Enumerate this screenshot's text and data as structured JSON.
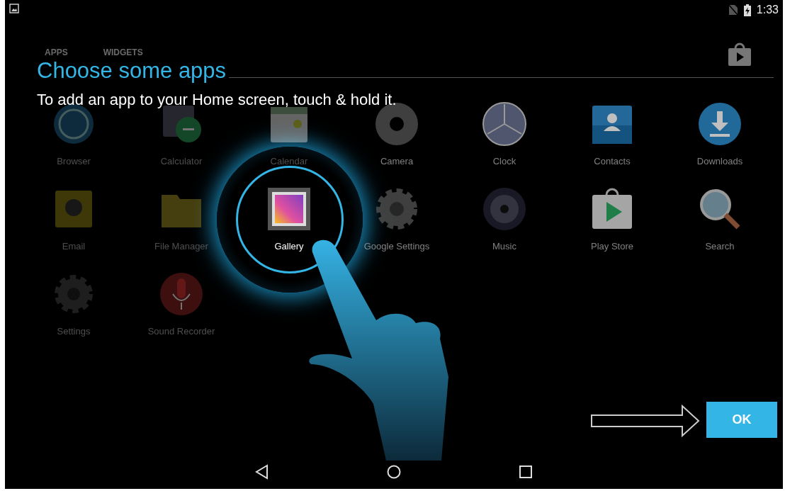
{
  "status_bar": {
    "time": "1:33"
  },
  "tabs": [
    "APPS",
    "WIDGETS"
  ],
  "apps": [
    {
      "label": "Browser",
      "dimmed": true,
      "spotlight": false
    },
    {
      "label": "Calculator",
      "dimmed": true,
      "spotlight": false
    },
    {
      "label": "Calendar",
      "dimmed": true,
      "spotlight": false
    },
    {
      "label": "Camera",
      "dimmed": false,
      "spotlight": false
    },
    {
      "label": "Clock",
      "dimmed": false,
      "spotlight": false
    },
    {
      "label": "Contacts",
      "dimmed": false,
      "spotlight": false
    },
    {
      "label": "Downloads",
      "dimmed": false,
      "spotlight": false
    },
    {
      "label": "Email",
      "dimmed": true,
      "spotlight": false
    },
    {
      "label": "File Manager",
      "dimmed": true,
      "spotlight": false
    },
    {
      "label": "Gallery",
      "dimmed": false,
      "spotlight": true
    },
    {
      "label": "Google Settings",
      "dimmed": false,
      "spotlight": false
    },
    {
      "label": "Music",
      "dimmed": false,
      "spotlight": false
    },
    {
      "label": "Play Store",
      "dimmed": false,
      "spotlight": false
    },
    {
      "label": "Search",
      "dimmed": false,
      "spotlight": false
    },
    {
      "label": "Settings",
      "dimmed": true,
      "spotlight": false
    },
    {
      "label": "Sound Recorder",
      "dimmed": true,
      "spotlight": false
    }
  ],
  "cling": {
    "title": "Choose some apps",
    "message": "To add an app to your Home screen, touch & hold it.",
    "button": "OK"
  }
}
